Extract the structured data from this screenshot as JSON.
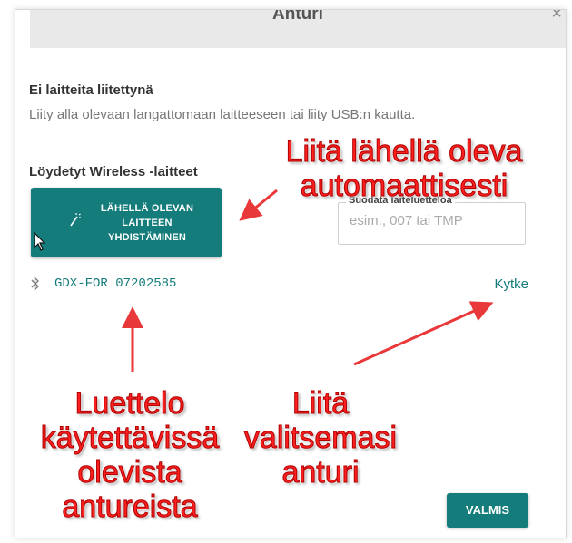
{
  "dialog": {
    "title": "Anturi",
    "close_glyph": "×"
  },
  "status": {
    "heading": "Ei laitteita liitettynä",
    "subtext": "Liity alla olevaan langattomaan laitteeseen tai liity USB:n kautta."
  },
  "wireless": {
    "heading": "Löydetyt Wireless -laitteet",
    "pair_button_label": "LÄHELLÄ OLEVAN LAITTEEN YHDISTÄMINEN",
    "pair_icon": "wand-icon",
    "filter": {
      "label": "Suodata laiteluetteloa",
      "placeholder": "esim., 007 tai TMP",
      "value": ""
    },
    "devices": [
      {
        "icon": "bluetooth-icon",
        "name": "GDX-FOR 07202585",
        "action": "Kytke"
      }
    ]
  },
  "footer": {
    "done_label": "VALMIS"
  },
  "annotations": {
    "pair": "Liitä lähellä oleva automaattisesti",
    "list": "Luettelo käytettävissä olevista antureista",
    "connect": "Liitä valitsemasi anturi",
    "color": "#ff2020"
  },
  "colors": {
    "accent": "#147c7a",
    "header_bg": "#e9e9e9"
  }
}
